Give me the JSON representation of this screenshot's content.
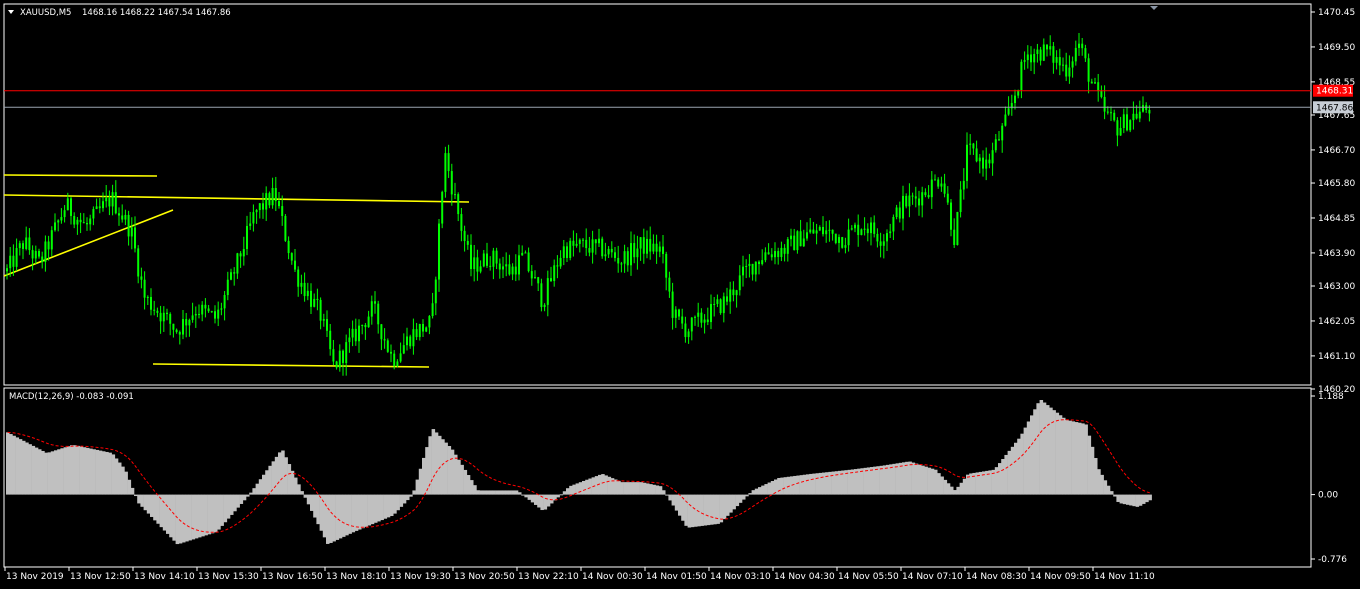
{
  "header": {
    "symbol": "XAUUSD,M5",
    "ohlc": "1468.16 1468.22 1467.54 1467.86"
  },
  "macd": {
    "label": "MACD(12,26,9) -0.083 -0.091",
    "ticks": [
      "1.188",
      "0.00",
      "-0.776"
    ]
  },
  "colors": {
    "background": "#000000",
    "candle": "#00ff00",
    "trendline": "#ffff00",
    "ask_line": "#ff0000",
    "bid_line": "#9aa4b0",
    "histogram": "#c0c0c0",
    "signal": "#ff0000",
    "frame": "#ffffff"
  },
  "chart_data": {
    "type": "candlestick",
    "symbol": "XAUUSD",
    "timeframe": "M5",
    "price_ticks": [
      "1470.45",
      "1469.50",
      "1468.55",
      "1467.65",
      "1466.70",
      "1465.80",
      "1464.85",
      "1463.90",
      "1463.00",
      "1462.05",
      "1461.10",
      "1460.20"
    ],
    "ylim": [
      1460.2,
      1470.45
    ],
    "ask_price": "1468.31",
    "bid_price": "1467.86",
    "time_labels": [
      "13 Nov 2019",
      "13 Nov 12:50",
      "13 Nov 14:10",
      "13 Nov 15:30",
      "13 Nov 16:50",
      "13 Nov 18:10",
      "13 Nov 19:30",
      "13 Nov 20:50",
      "13 Nov 22:10",
      "14 Nov 00:30",
      "14 Nov 01:50",
      "14 Nov 03:10",
      "14 Nov 04:30",
      "14 Nov 05:50",
      "14 Nov 07:10",
      "14 Nov 08:30",
      "14 Nov 09:50",
      "14 Nov 11:10"
    ],
    "price_anchors": [
      [
        0,
        1463.4
      ],
      [
        0.013,
        1464.2
      ],
      [
        0.025,
        1463.6
      ],
      [
        0.045,
        1465.2
      ],
      [
        0.06,
        1464.6
      ],
      [
        0.08,
        1465.4
      ],
      [
        0.095,
        1464.5
      ],
      [
        0.105,
        1462.7
      ],
      [
        0.13,
        1461.8
      ],
      [
        0.145,
        1462.4
      ],
      [
        0.16,
        1462.1
      ],
      [
        0.175,
        1463.5
      ],
      [
        0.19,
        1465.0
      ],
      [
        0.205,
        1465.5
      ],
      [
        0.22,
        1463.4
      ],
      [
        0.24,
        1462.2
      ],
      [
        0.25,
        1460.8
      ],
      [
        0.265,
        1461.6
      ],
      [
        0.28,
        1462.4
      ],
      [
        0.295,
        1461.0
      ],
      [
        0.31,
        1461.7
      ],
      [
        0.325,
        1462.0
      ],
      [
        0.335,
        1466.6
      ],
      [
        0.345,
        1465.0
      ],
      [
        0.355,
        1463.5
      ],
      [
        0.37,
        1463.8
      ],
      [
        0.385,
        1463.4
      ],
      [
        0.395,
        1463.8
      ],
      [
        0.41,
        1462.6
      ],
      [
        0.425,
        1464.0
      ],
      [
        0.44,
        1464.1
      ],
      [
        0.455,
        1464.0
      ],
      [
        0.47,
        1463.7
      ],
      [
        0.485,
        1464.1
      ],
      [
        0.5,
        1464.0
      ],
      [
        0.51,
        1462.2
      ],
      [
        0.52,
        1461.8
      ],
      [
        0.535,
        1462.2
      ],
      [
        0.55,
        1462.6
      ],
      [
        0.565,
        1463.4
      ],
      [
        0.58,
        1463.9
      ],
      [
        0.595,
        1464.0
      ],
      [
        0.61,
        1464.4
      ],
      [
        0.625,
        1464.5
      ],
      [
        0.64,
        1464.3
      ],
      [
        0.655,
        1464.7
      ],
      [
        0.67,
        1464.3
      ],
      [
        0.685,
        1465.2
      ],
      [
        0.7,
        1465.5
      ],
      [
        0.715,
        1466.0
      ],
      [
        0.725,
        1464.3
      ],
      [
        0.735,
        1466.7
      ],
      [
        0.75,
        1466.3
      ],
      [
        0.765,
        1467.5
      ],
      [
        0.78,
        1469.3
      ],
      [
        0.795,
        1469.4
      ],
      [
        0.81,
        1468.9
      ],
      [
        0.82,
        1469.6
      ],
      [
        0.83,
        1468.5
      ],
      [
        0.84,
        1467.7
      ],
      [
        0.85,
        1467.3
      ],
      [
        0.86,
        1467.6
      ],
      [
        0.875,
        1467.86
      ]
    ],
    "macd_ylim": [
      -0.776,
      1.188
    ],
    "macd_anchors": [
      [
        0,
        0.75
      ],
      [
        0.03,
        0.5
      ],
      [
        0.05,
        0.6
      ],
      [
        0.08,
        0.5
      ],
      [
        0.09,
        0.3
      ],
      [
        0.1,
        -0.1
      ],
      [
        0.13,
        -0.6
      ],
      [
        0.16,
        -0.45
      ],
      [
        0.185,
        0.0
      ],
      [
        0.21,
        0.55
      ],
      [
        0.225,
        0.05
      ],
      [
        0.245,
        -0.6
      ],
      [
        0.265,
        -0.45
      ],
      [
        0.295,
        -0.25
      ],
      [
        0.31,
        0.0
      ],
      [
        0.325,
        0.8
      ],
      [
        0.34,
        0.55
      ],
      [
        0.36,
        0.05
      ],
      [
        0.39,
        0.05
      ],
      [
        0.41,
        -0.2
      ],
      [
        0.43,
        0.1
      ],
      [
        0.455,
        0.25
      ],
      [
        0.47,
        0.15
      ],
      [
        0.485,
        0.15
      ],
      [
        0.5,
        0.1
      ],
      [
        0.52,
        -0.4
      ],
      [
        0.545,
        -0.35
      ],
      [
        0.57,
        0.05
      ],
      [
        0.59,
        0.2
      ],
      [
        0.615,
        0.25
      ],
      [
        0.645,
        0.3
      ],
      [
        0.67,
        0.35
      ],
      [
        0.69,
        0.4
      ],
      [
        0.71,
        0.3
      ],
      [
        0.725,
        0.05
      ],
      [
        0.735,
        0.25
      ],
      [
        0.755,
        0.3
      ],
      [
        0.775,
        0.7
      ],
      [
        0.79,
        1.15
      ],
      [
        0.81,
        0.9
      ],
      [
        0.825,
        0.85
      ],
      [
        0.835,
        0.3
      ],
      [
        0.85,
        -0.1
      ],
      [
        0.865,
        -0.15
      ],
      [
        0.875,
        -0.06
      ]
    ]
  }
}
